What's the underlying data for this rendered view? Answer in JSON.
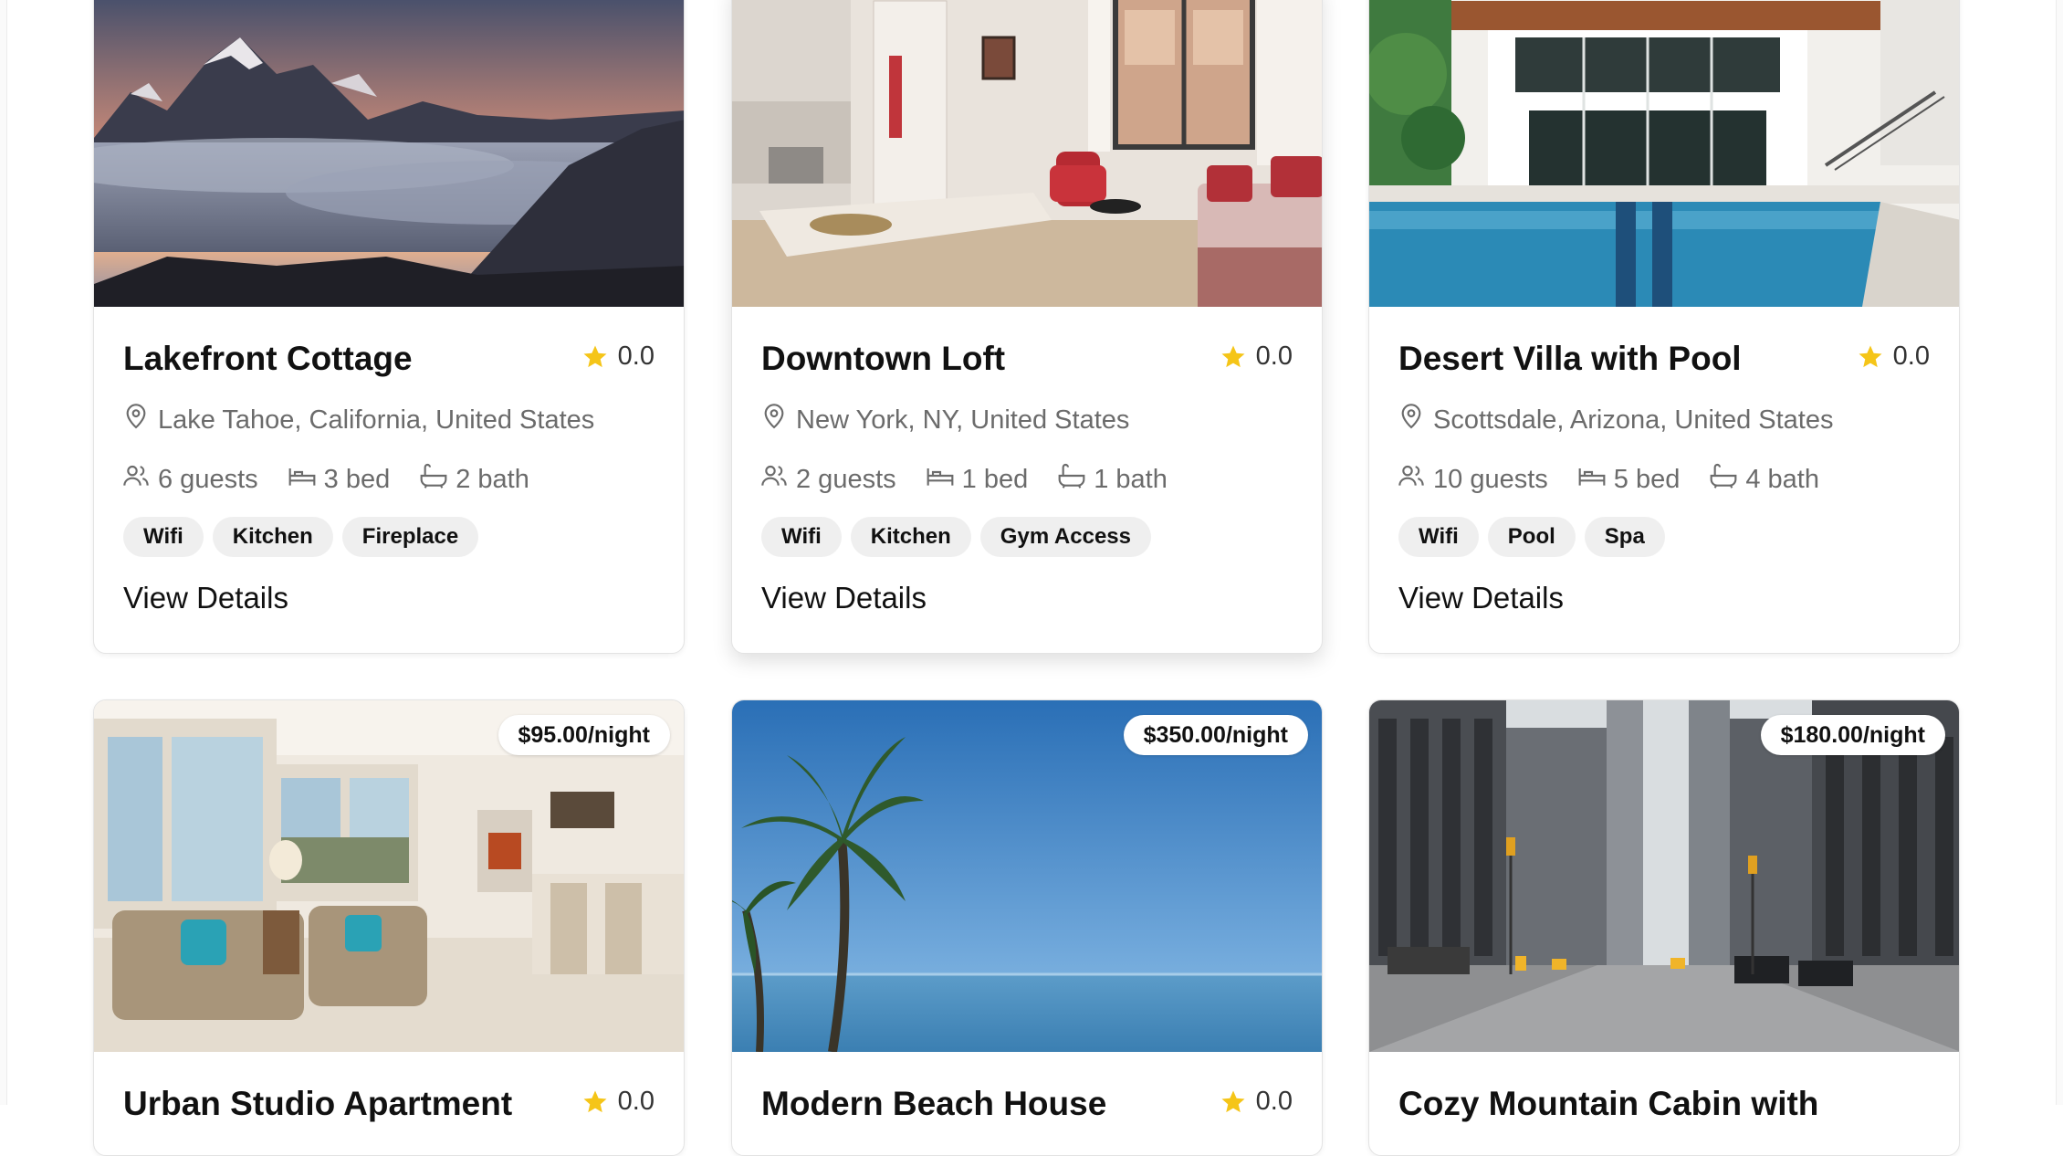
{
  "listings": [
    {
      "title": "Lakefront Cottage",
      "rating": "0.0",
      "location": "Lake Tahoe, California, United States",
      "guests": "6 guests",
      "beds": "3 bed",
      "baths": "2 bath",
      "amenities": [
        "Wifi",
        "Kitchen",
        "Fireplace"
      ],
      "view_label": "View Details"
    },
    {
      "title": "Downtown Loft",
      "rating": "0.0",
      "location": "New York, NY, United States",
      "guests": "2 guests",
      "beds": "1 bed",
      "baths": "1 bath",
      "amenities": [
        "Wifi",
        "Kitchen",
        "Gym Access"
      ],
      "view_label": "View Details"
    },
    {
      "title": "Desert Villa with Pool",
      "rating": "0.0",
      "location": "Scottsdale, Arizona, United States",
      "guests": "10 guests",
      "beds": "5 bed",
      "baths": "4 bath",
      "amenities": [
        "Wifi",
        "Pool",
        "Spa"
      ],
      "view_label": "View Details"
    },
    {
      "title": "Urban Studio Apartment",
      "price": "$95.00/night",
      "rating": "0.0"
    },
    {
      "title": "Modern Beach House",
      "price": "$350.00/night",
      "rating": "0.0"
    },
    {
      "title": "Cozy Mountain Cabin with",
      "price": "$180.00/night",
      "rating": "0.0"
    }
  ],
  "icons": {
    "rating": "star-icon",
    "location": "map-pin-icon",
    "guests": "users-icon",
    "beds": "bed-icon",
    "baths": "bath-icon"
  },
  "colors": {
    "star": "#f5c518",
    "muted_text": "#6b6b6b",
    "chip_bg": "#efefef"
  }
}
